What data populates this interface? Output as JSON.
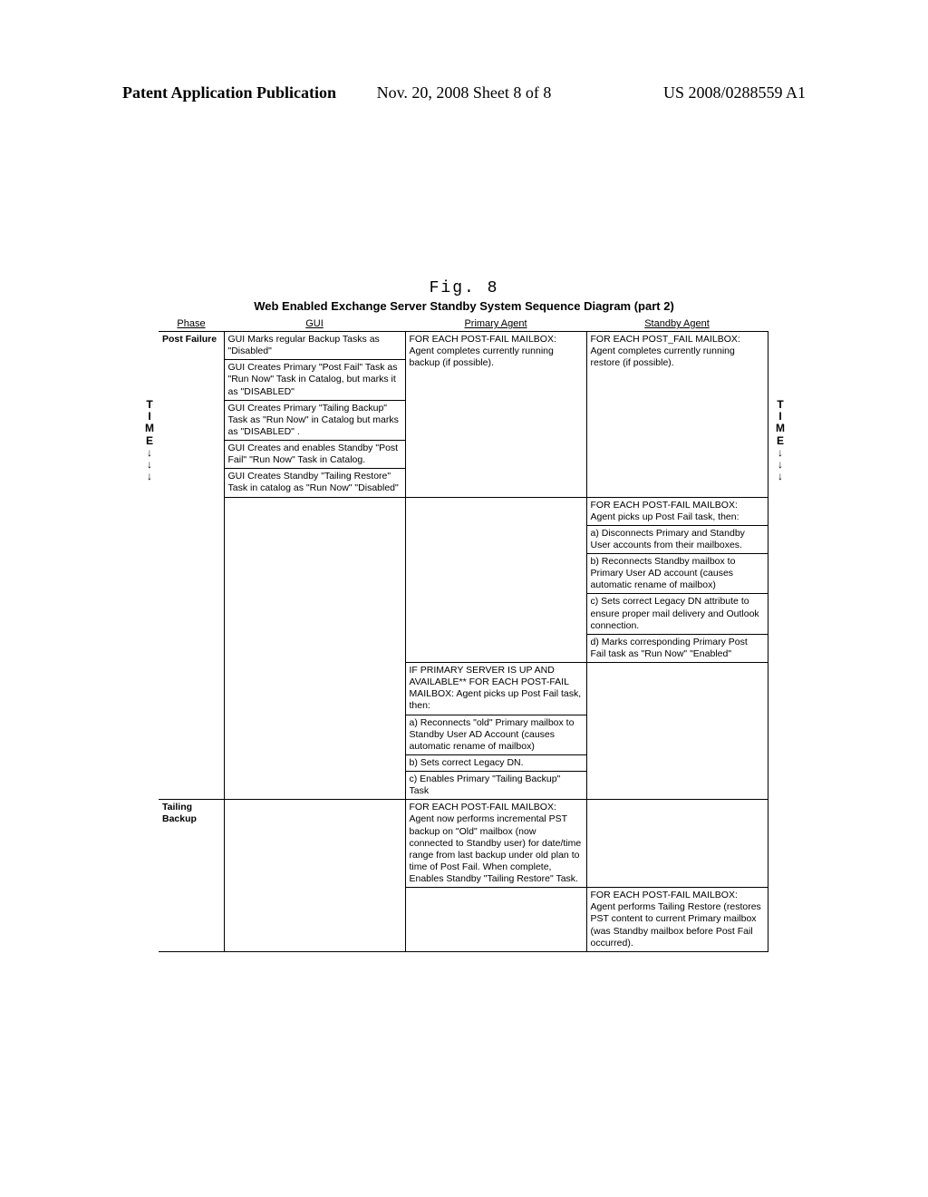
{
  "header": {
    "left": "Patent Application Publication",
    "center": "Nov. 20, 2008  Sheet 8 of 8",
    "right": "US 2008/0288559 A1"
  },
  "figure_label": "Fig. 8",
  "subtitle": "Web Enabled Exchange Server Standby System Sequence Diagram (part 2)",
  "time_marker": "TIME↓↓↓",
  "columns": {
    "phase": "Phase",
    "gui": "GUI",
    "primary": "Primary Agent",
    "standby": "Standby Agent"
  },
  "rows": [
    {
      "phase": "Post Failure",
      "gui": "GUI Marks regular Backup Tasks as \"Disabled\"",
      "primary": "FOR EACH POST-FAIL MAILBOX: Agent completes currently running backup (if possible).",
      "standby": "FOR EACH POST_FAIL MAILBOX: Agent completes currently running restore (if possible)."
    },
    {
      "phase": "",
      "gui": "GUI Creates Primary \"Post Fail\" Task as \"Run Now\" Task in Catalog, but marks it as \"DISABLED\"",
      "primary": "",
      "standby": ""
    },
    {
      "phase": "",
      "gui": "GUI Creates Primary \"Tailing Backup\" Task as \"Run Now\" in Catalog but marks as \"DISABLED\" .",
      "primary": "",
      "standby": ""
    },
    {
      "phase": "",
      "gui": "GUI Creates and enables Standby \"Post Fail\" \"Run Now\" Task in Catalog.",
      "primary": "",
      "standby": ""
    },
    {
      "phase": "",
      "gui": "GUI Creates Standby \"Tailing Restore\" Task in catalog as \"Run Now\" \"Disabled\"",
      "primary": "",
      "standby": ""
    },
    {
      "phase": "",
      "gui": "",
      "primary": "",
      "standby": "FOR EACH POST-FAIL MAILBOX: Agent picks up Post Fail task, then:"
    },
    {
      "phase": "",
      "gui": "",
      "primary": "",
      "standby": "a) Disconnects Primary and Standby User accounts from their mailboxes."
    },
    {
      "phase": "",
      "gui": "",
      "primary": "",
      "standby": "b) Reconnects Standby mailbox to Primary User AD account (causes automatic rename of mailbox)"
    },
    {
      "phase": "",
      "gui": "",
      "primary": "",
      "standby": "c) Sets correct Legacy DN attribute to ensure proper mail delivery and Outlook connection."
    },
    {
      "phase": "",
      "gui": "",
      "primary": "",
      "standby": "d) Marks corresponding Primary Post Fail task as \"Run Now\" \"Enabled\""
    },
    {
      "phase": "",
      "gui": "",
      "primary": "IF PRIMARY SERVER IS UP AND AVAILABLE** FOR EACH POST-FAIL MAILBOX: Agent picks up Post Fail task, then:",
      "standby": ""
    },
    {
      "phase": "",
      "gui": "",
      "primary": "a) Reconnects \"old\" Primary mailbox to Standby User AD Account (causes automatic rename of mailbox)",
      "standby": ""
    },
    {
      "phase": "",
      "gui": "",
      "primary": "b) Sets correct Legacy DN.",
      "standby": ""
    },
    {
      "phase": "",
      "gui": "",
      "primary": "c) Enables Primary \"Tailing Backup\" Task",
      "standby": ""
    },
    {
      "phase": "Tailing Backup",
      "gui": "",
      "primary": "FOR EACH POST-FAIL MAILBOX: Agent now performs incremental PST backup on \"Old\" mailbox (now connected to Standby user) for date/time range from last backup under old plan to time of Post Fail. When complete, Enables Standby \"Tailing Restore\" Task.",
      "standby": ""
    },
    {
      "phase": "",
      "gui": "",
      "primary": "",
      "standby": "FOR EACH POST-FAIL MAILBOX: Agent performs Tailing Restore (restores PST content to current Primary mailbox (was Standby mailbox before Post Fail occurred)."
    }
  ]
}
